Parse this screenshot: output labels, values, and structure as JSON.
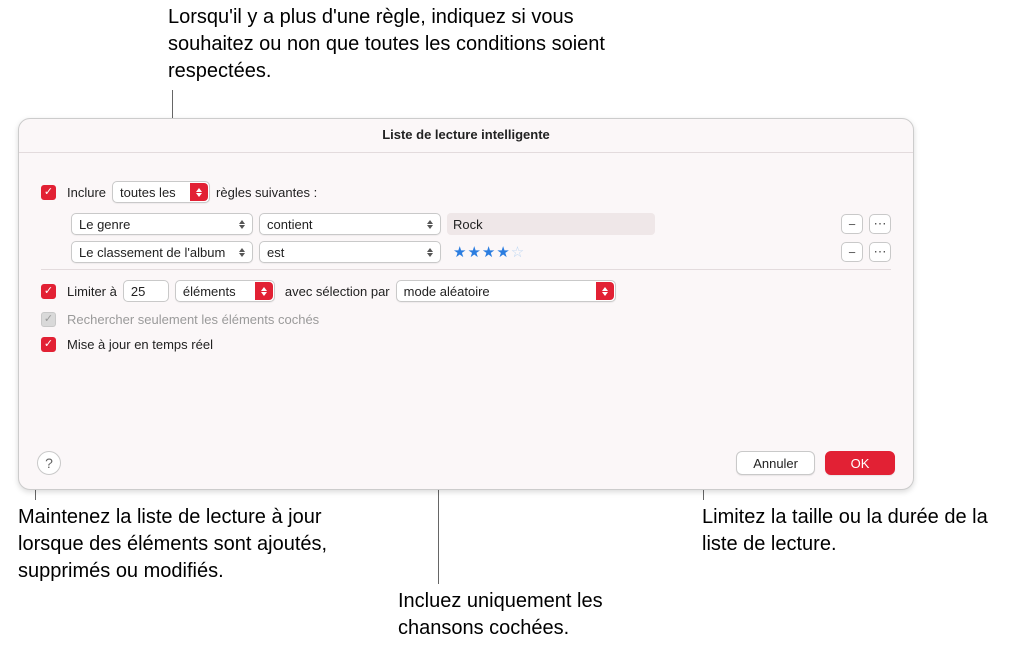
{
  "callouts": {
    "top": "Lorsqu'il y a plus d'une règle, indiquez si vous souhaitez ou non que toutes les conditions soient respectées.",
    "bottom_left": "Maintenez la liste de lecture à jour lorsque des éléments sont ajoutés, supprimés ou modifiés.",
    "bottom_mid": "Incluez uniquement les chansons cochées.",
    "bottom_right": "Limitez la taille ou la durée de la liste de lecture."
  },
  "dialog": {
    "title": "Liste de lecture intelligente",
    "include": {
      "label_prefix": "Inclure",
      "match_mode": "toutes les",
      "label_suffix": "règles suivantes :"
    },
    "rules": [
      {
        "field": "Le genre",
        "condition": "contient",
        "value_type": "text",
        "value": "Rock"
      },
      {
        "field": "Le classement de l'album",
        "condition": "est",
        "value_type": "rating",
        "rating": 4,
        "rating_max": 5
      }
    ],
    "limit": {
      "label": "Limiter à",
      "value": "25",
      "unit": "éléments",
      "selection_label": "avec sélection par",
      "selection_mode": "mode aléatoire"
    },
    "checked_only": {
      "label": "Rechercher seulement les éléments cochés",
      "checked": true,
      "disabled": true
    },
    "live_update": {
      "label": "Mise à jour en temps réel",
      "checked": true
    },
    "buttons": {
      "cancel": "Annuler",
      "ok": "OK",
      "help": "?"
    },
    "icons": {
      "minus": "−",
      "more": "⋯",
      "check": "✓"
    }
  }
}
